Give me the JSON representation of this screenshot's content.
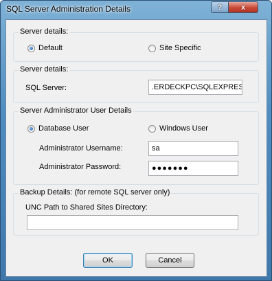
{
  "window": {
    "title": "SQL Server Administration Details",
    "help_icon": "?",
    "close_icon": "x"
  },
  "group1": {
    "label": "Server details:",
    "options": [
      {
        "label": "Default",
        "selected": true
      },
      {
        "label": "Site Specific",
        "selected": false
      }
    ]
  },
  "group2": {
    "label": "Server details:",
    "sql_server_label": "SQL Server:",
    "sql_server_value": ".ERDECKPC\\SQLEXPRESS"
  },
  "group3": {
    "label": "Server Administrator User Details",
    "options": [
      {
        "label": "Database User",
        "selected": true
      },
      {
        "label": "Windows User",
        "selected": false
      }
    ],
    "username_label": "Administrator Username:",
    "username_value": "sa",
    "password_label": "Administrator Password:",
    "password_value": "●●●●●●●"
  },
  "group4": {
    "label": "Backup Details: (for remote SQL server only)",
    "unc_label": "UNC Path to Shared Sites Directory:",
    "unc_value": ""
  },
  "buttons": {
    "ok": "OK",
    "cancel": "Cancel"
  }
}
